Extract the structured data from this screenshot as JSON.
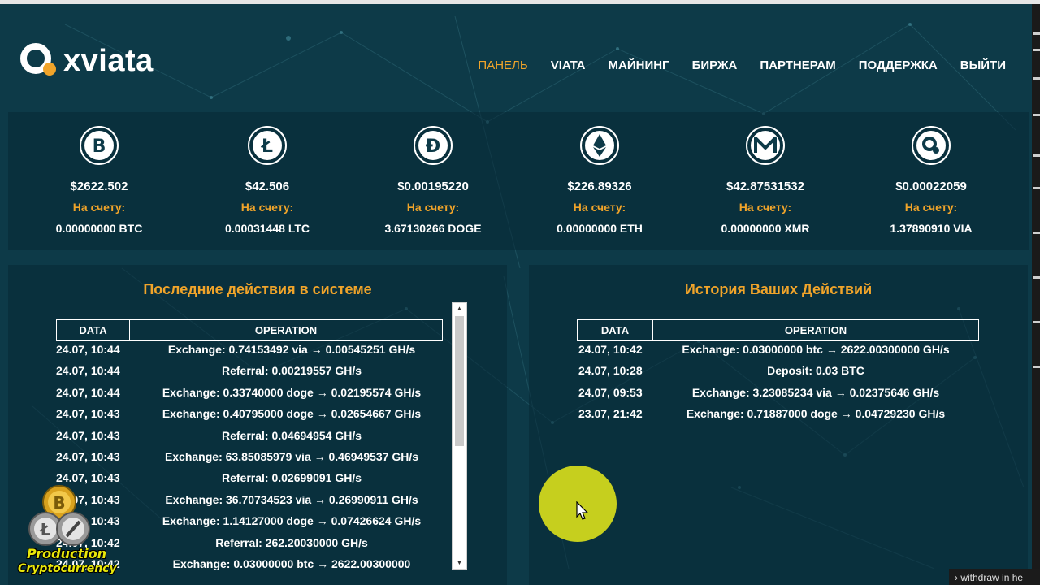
{
  "header": {
    "logo_text": "xviata",
    "nav": [
      {
        "label": "ПАНЕЛЬ",
        "active": true
      },
      {
        "label": "VIATA",
        "active": false
      },
      {
        "label": "МАЙНИНГ",
        "active": false
      },
      {
        "label": "БИРЖА",
        "active": false
      },
      {
        "label": "ПАРТНЕРАМ",
        "active": false
      },
      {
        "label": "ПОДДЕРЖКА",
        "active": false
      },
      {
        "label": "ВЫЙТИ",
        "active": false
      }
    ]
  },
  "coins": [
    {
      "icon": "bitcoin-icon",
      "price": "$2622.502",
      "label": "На счету:",
      "balance": "0.00000000 BTC"
    },
    {
      "icon": "litecoin-icon",
      "price": "$42.506",
      "label": "На счету:",
      "balance": "0.00031448 LTC"
    },
    {
      "icon": "dogecoin-icon",
      "price": "$0.00195220",
      "label": "На счету:",
      "balance": "3.67130266 DOGE"
    },
    {
      "icon": "ethereum-icon",
      "price": "$226.89326",
      "label": "На счету:",
      "balance": "0.00000000 ETH"
    },
    {
      "icon": "monero-icon",
      "price": "$42.87531532",
      "label": "На счету:",
      "balance": "0.00000000 XMR"
    },
    {
      "icon": "viata-icon",
      "price": "$0.00022059",
      "label": "На счету:",
      "balance": "1.37890910 VIA"
    }
  ],
  "recent": {
    "title": "Последние действия в системе",
    "headers": [
      "DATA",
      "OPERATION"
    ],
    "rows": [
      {
        "date": "24.07, 10:44",
        "op": "Exchange: 0.74153492 via → 0.00545251 GH/s"
      },
      {
        "date": "24.07, 10:44",
        "op": "Referral: 0.00219557 GH/s"
      },
      {
        "date": "24.07, 10:44",
        "op": "Exchange: 0.33740000 doge → 0.02195574 GH/s"
      },
      {
        "date": "24.07, 10:43",
        "op": "Exchange: 0.40795000 doge → 0.02654667 GH/s"
      },
      {
        "date": "24.07, 10:43",
        "op": "Referral: 0.04694954 GH/s"
      },
      {
        "date": "24.07, 10:43",
        "op": "Exchange: 63.85085979 via → 0.46949537 GH/s"
      },
      {
        "date": "24.07, 10:43",
        "op": "Referral: 0.02699091 GH/s"
      },
      {
        "date": "24.07, 10:43",
        "op": "Exchange: 36.70734523 via → 0.26990911 GH/s"
      },
      {
        "date": "24.07, 10:43",
        "op": "Exchange: 1.14127000 doge → 0.07426624 GH/s"
      },
      {
        "date": "24.07, 10:42",
        "op": "Referral: 262.20030000 GH/s"
      },
      {
        "date": "24.07, 10:42",
        "op": "Exchange: 0.03000000 btc → 2622.00300000"
      }
    ]
  },
  "history": {
    "title": "История Ваших Действий",
    "headers": [
      "DATA",
      "OPERATION"
    ],
    "rows": [
      {
        "date": "24.07, 10:42",
        "op": "Exchange: 0.03000000 btc → 2622.00300000 GH/s"
      },
      {
        "date": "24.07, 10:28",
        "op": "Deposit: 0.03 BTC"
      },
      {
        "date": "24.07, 09:53",
        "op": "Exchange: 3.23085234 via → 0.02375646 GH/s"
      },
      {
        "date": "23.07, 21:42",
        "op": "Exchange: 0.71887000 doge → 0.04729230 GH/s"
      }
    ]
  },
  "watermark": {
    "line1": "Production",
    "line2": "Cryptocurrency"
  },
  "tooltip": "withdraw in he",
  "colors": {
    "background": "#0d3a48",
    "accent": "#f0a42a",
    "panel": "#08283a",
    "cursor_highlight": "#c6cf1e"
  }
}
